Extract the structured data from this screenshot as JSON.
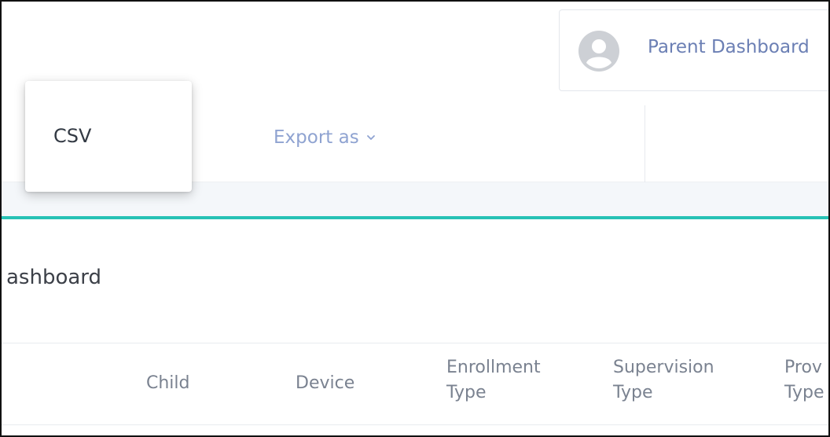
{
  "header": {
    "user_label": "Parent Dashboard"
  },
  "toolbar": {
    "export_label": "Export as"
  },
  "dropdown": {
    "items": [
      "CSV"
    ]
  },
  "page": {
    "title": "ashboard"
  },
  "table": {
    "columns": [
      {
        "line1": "Child",
        "line2": ""
      },
      {
        "line1": "Device",
        "line2": ""
      },
      {
        "line1": "Enrollment",
        "line2": "Type"
      },
      {
        "line1": "Supervision",
        "line2": "Type"
      },
      {
        "line1": "Prov",
        "line2": "Type"
      }
    ]
  },
  "colors": {
    "accent": "#27c2b5",
    "link": "#6b7fb4",
    "export_link": "#8fa3d1"
  },
  "icons": {
    "avatar": "user-avatar-icon",
    "export_chevron": "chevron-down-icon"
  }
}
